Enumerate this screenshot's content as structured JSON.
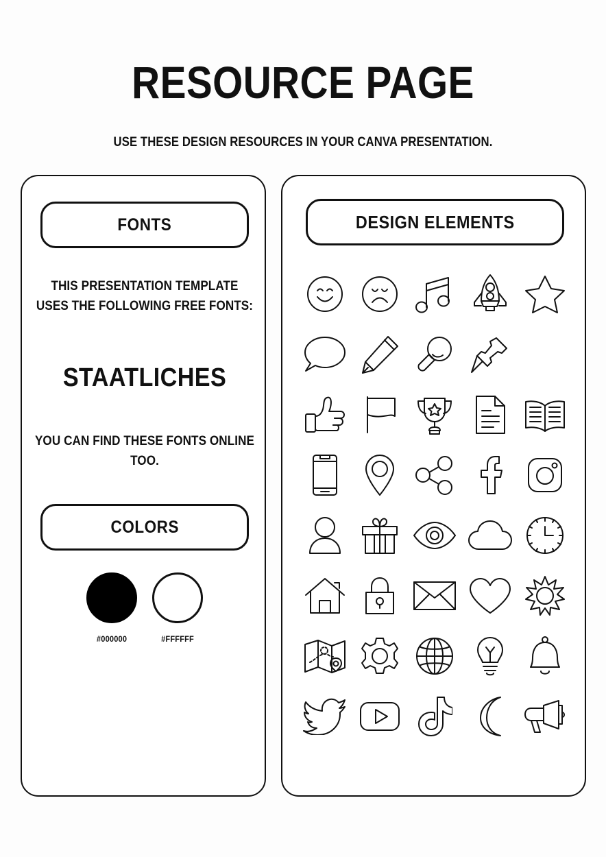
{
  "header": {
    "title": "RESOURCE PAGE",
    "subtitle": "USE THESE DESIGN RESOURCES IN YOUR CANVA PRESENTATION."
  },
  "fonts_panel": {
    "section_label": "FONTS",
    "intro_line_1": "THIS PRESENTATION TEMPLATE",
    "intro_line_2": "USES THE FOLLOWING FREE FONTS:",
    "font_name": "STAATLICHES",
    "outro_line_1": "YOU CAN FIND THESE FONTS ONLINE",
    "outro_line_2": "TOO."
  },
  "colors_panel": {
    "section_label": "COLORS",
    "swatches": [
      {
        "name": "black-swatch",
        "hex": "#000000",
        "fill": "#000000"
      },
      {
        "name": "white-swatch",
        "hex": "#FFFFFF",
        "fill": "#FFFFFF"
      }
    ]
  },
  "elements_panel": {
    "section_label": "DESIGN ELEMENTS",
    "icons": [
      "smiley-face-icon",
      "sad-face-icon",
      "music-notes-icon",
      "rocket-icon",
      "star-icon",
      "speech-bubble-icon",
      "pencil-icon",
      "magnifying-glass-icon",
      "push-pin-icon",
      "empty-slot",
      "thumbs-up-icon",
      "flag-icon",
      "trophy-icon",
      "document-icon",
      "open-book-icon",
      "smartphone-icon",
      "location-pin-icon",
      "share-icon",
      "facebook-icon",
      "instagram-icon",
      "user-icon",
      "gift-icon",
      "eye-icon",
      "cloud-icon",
      "clock-icon",
      "house-icon",
      "lock-icon",
      "envelope-icon",
      "heart-icon",
      "sun-icon",
      "map-icon",
      "gear-icon",
      "globe-icon",
      "lightbulb-icon",
      "bell-icon",
      "twitter-icon",
      "youtube-icon",
      "tiktok-icon",
      "moon-icon",
      "megaphone-icon"
    ]
  },
  "theme": {
    "background": "#FDFDFD",
    "ink": "#111111",
    "panel_fill": "#FFFFFF"
  }
}
